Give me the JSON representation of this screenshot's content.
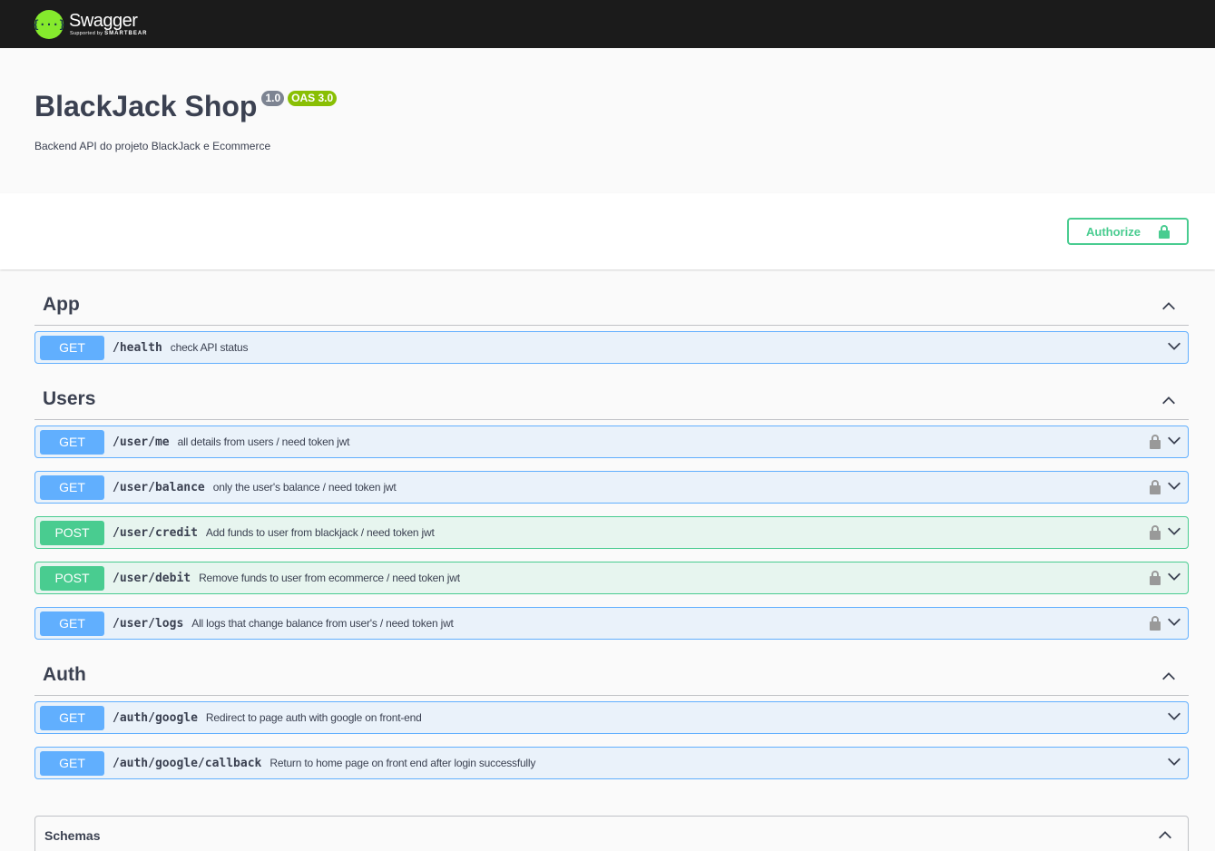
{
  "topbar": {
    "logo_mark": "{···}",
    "logo_name": "Swagger",
    "logo_sub_prefix": "Supported by",
    "logo_sub_brand": "SMARTBEAR"
  },
  "info": {
    "title": "BlackJack Shop",
    "version": "1.0",
    "oas": "OAS 3.0",
    "description": "Backend API do projeto BlackJack e Ecommerce"
  },
  "authorize": {
    "label": "Authorize"
  },
  "tags": [
    {
      "name": "App",
      "operations": [
        {
          "method": "GET",
          "path": "/health",
          "summary": "check API status",
          "locked": false
        }
      ]
    },
    {
      "name": "Users",
      "operations": [
        {
          "method": "GET",
          "path": "/user/me",
          "summary": "all details from users / need token jwt",
          "locked": true
        },
        {
          "method": "GET",
          "path": "/user/balance",
          "summary": "only the user's balance / need token jwt",
          "locked": true
        },
        {
          "method": "POST",
          "path": "/user/credit",
          "summary": "Add funds to user from blackjack / need token jwt",
          "locked": true
        },
        {
          "method": "POST",
          "path": "/user/debit",
          "summary": "Remove funds to user from ecommerce / need token jwt",
          "locked": true
        },
        {
          "method": "GET",
          "path": "/user/logs",
          "summary": "All logs that change balance from user's / need token jwt",
          "locked": true
        }
      ]
    },
    {
      "name": "Auth",
      "operations": [
        {
          "method": "GET",
          "path": "/auth/google",
          "summary": "Redirect to page auth with google on front-end",
          "locked": false
        },
        {
          "method": "GET",
          "path": "/auth/google/callback",
          "summary": "Return to home page on front end after login successfully",
          "locked": false
        }
      ]
    }
  ],
  "schemas": {
    "title": "Schemas"
  },
  "colors": {
    "get": "#61affe",
    "post": "#49cc90",
    "topbar": "#1b1b1b",
    "logo": "#85ea2d",
    "oas_badge": "#89bf04"
  }
}
